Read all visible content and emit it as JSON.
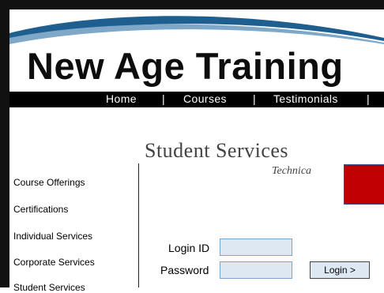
{
  "header": {
    "logo_text": "New Age Training",
    "nav": [
      "Home",
      "Courses",
      "Testimonials"
    ]
  },
  "main": {
    "title": "Student Services",
    "subtitle": "Technica"
  },
  "sidebar": {
    "items": [
      {
        "label": "Course Offerings"
      },
      {
        "label": "Certifications"
      },
      {
        "label": "Individual Services"
      },
      {
        "label": "Corporate Services"
      },
      {
        "label": "Student Services"
      }
    ]
  },
  "login": {
    "id_label": "Login ID",
    "password_label": "Password",
    "id_value": "",
    "password_value": "",
    "button_label": "Login  >"
  },
  "colors": {
    "nav_background": "#000000",
    "swoosh": "#1f5f8f",
    "promo_box": "#c00000",
    "field_fill": "#dde8f3"
  }
}
